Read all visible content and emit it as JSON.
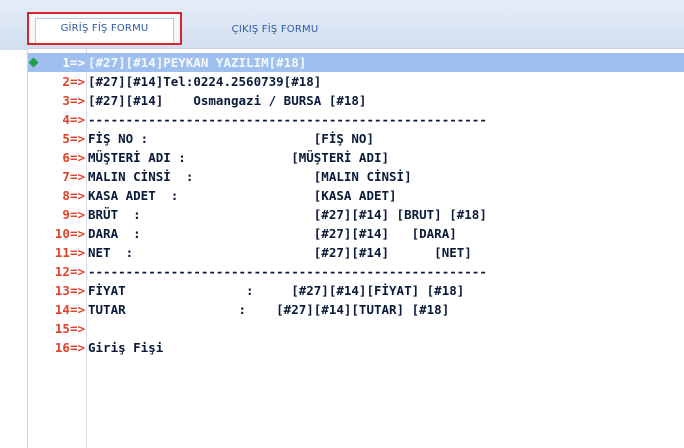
{
  "tabs": [
    {
      "label": "GİRİŞ FİŞ FORMU",
      "active": true
    },
    {
      "label": "ÇIKIŞ FİŞ FORMU",
      "active": false
    }
  ],
  "editor": {
    "current_line": 1,
    "lines": [
      {
        "num": "1=>",
        "text": "[#27][#14]PEYKAN YAZILIM[#18]"
      },
      {
        "num": "2=>",
        "text": "[#27][#14]Tel:0224.2560739[#18]"
      },
      {
        "num": "3=>",
        "text": "[#27][#14]    Osmangazi / BURSA [#18]"
      },
      {
        "num": "4=>",
        "text": "-----------------------------------------------------"
      },
      {
        "num": "5=>",
        "text": "FİŞ NO :                      [FİŞ NO]"
      },
      {
        "num": "6=>",
        "text": "MÜŞTERİ ADI :              [MÜŞTERİ ADI]"
      },
      {
        "num": "7=>",
        "text": "MALIN CİNSİ  :                [MALIN CİNSİ]"
      },
      {
        "num": "8=>",
        "text": "KASA ADET  :                  [KASA ADET]"
      },
      {
        "num": "9=>",
        "text": "BRÜT  :                       [#27][#14] [BRUT] [#18]"
      },
      {
        "num": "10=>",
        "text": "DARA  :                       [#27][#14]   [DARA]"
      },
      {
        "num": "11=>",
        "text": "NET  :                        [#27][#14]      [NET]"
      },
      {
        "num": "12=>",
        "text": "-----------------------------------------------------"
      },
      {
        "num": "13=>",
        "text": "FİYAT                :     [#27][#14][FİYAT] [#18]"
      },
      {
        "num": "14=>",
        "text": "TUTAR               :    [#27][#14][TUTAR] [#18]"
      },
      {
        "num": "15=>",
        "text": ""
      },
      {
        "num": "16=>",
        "text": "Giriş Fişi"
      }
    ]
  },
  "colors": {
    "line_number": "#e0432c",
    "highlight": "#9fc0ee",
    "active_tab_border": "#d9262b",
    "marker": "#22a047"
  }
}
